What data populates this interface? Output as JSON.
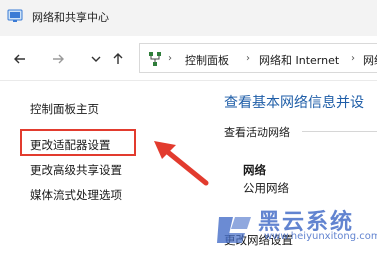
{
  "window": {
    "title": "网络和共享中心",
    "icon": "network-center-icon"
  },
  "toolbar": {
    "back_icon": "arrow-left-icon",
    "forward_icon": "arrow-right-icon",
    "up_icon": "arrow-up-icon",
    "breadcrumbs": [
      "控制面板",
      "网络和 Internet",
      "网络"
    ]
  },
  "sidebar": {
    "home": "控制面板主页",
    "items": [
      "更改适配器设置",
      "更改高级共享设置",
      "媒体流式处理选项"
    ]
  },
  "main": {
    "title": "查看基本网络信息并设",
    "active_networks_label": "查看活动网络",
    "network_name": "网络",
    "network_type": "公用网络",
    "change_settings_label": "更改网络设置"
  },
  "annotation": {
    "highlight_color": "#e23b2e",
    "target": "更改适配器设置"
  },
  "watermark": {
    "text": "黑云系统",
    "url": "www.heiyunxitong.com"
  },
  "colors": {
    "accent_title": "#1f5ea8",
    "titlebar_bg": "#f3f3f3"
  }
}
